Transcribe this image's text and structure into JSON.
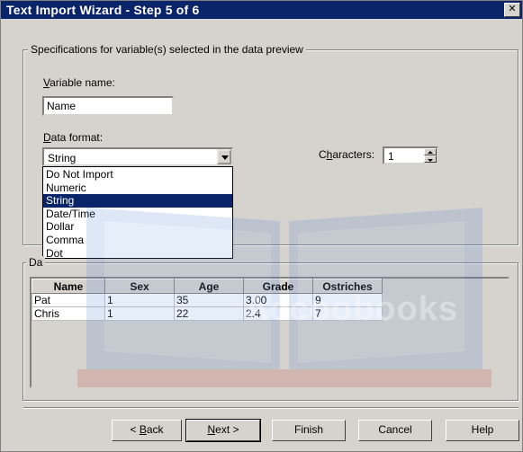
{
  "window": {
    "title": "Text Import Wizard - Step 5 of 6",
    "close_glyph": "✕"
  },
  "specs": {
    "legend": "Specifications for variable(s) selected in the data preview",
    "variable_name_label": "Variable name:",
    "variable_name_value": "Name",
    "data_format_label": "Data format:",
    "data_format_value": "String",
    "characters_label": "Characters:",
    "characters_value": "1",
    "format_options": [
      "Do Not Import",
      "Numeric",
      "String",
      "Date/Time",
      "Dollar",
      "Comma",
      "Dot"
    ],
    "format_selected_index": 2
  },
  "preview": {
    "legend": "Da",
    "columns": [
      "Name",
      "Sex",
      "Age",
      "Grade",
      "Ostriches"
    ],
    "rows": [
      [
        "Pat",
        "1",
        "35",
        "3.00",
        "9"
      ],
      [
        "Chris",
        "1",
        "22",
        "2.4",
        "7"
      ]
    ]
  },
  "buttons": {
    "back": "< Back",
    "next": "Next >",
    "finish": "Finish",
    "cancel": "Cancel",
    "help": "Help"
  },
  "watermark": {
    "text": "Accoobooks"
  },
  "colors": {
    "titlebar": "#0a246a",
    "face": "#d6d3ce",
    "selection": "#0a246a"
  }
}
